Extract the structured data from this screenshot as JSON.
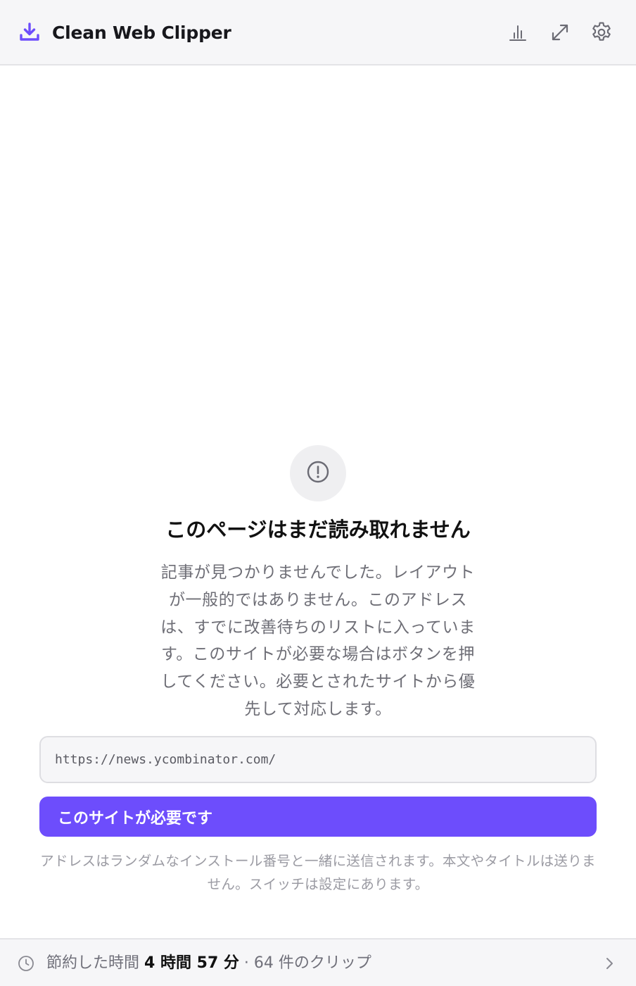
{
  "header": {
    "title": "Clean Web Clipper",
    "brand_icon": "download-tray-icon",
    "actions": [
      {
        "name": "stats-icon"
      },
      {
        "name": "expand-icon"
      },
      {
        "name": "gear-icon"
      }
    ]
  },
  "error": {
    "icon": "alert-circle-icon",
    "title": "このページはまだ読み取れません",
    "body": "記事が見つかりませんでした。レイアウトが一般的ではありません。このアドレスは、すでに改善待ちのリストに入っています。このサイトが必要な場合はボタンを押してください。必要とされたサイトから優先して対応します。"
  },
  "url_field": {
    "value": "https://news.ycombinator.com/"
  },
  "primary_button": {
    "label": "このサイトが必要です"
  },
  "note": "アドレスはランダムなインストール番号と一緒に送信されます。本文やタイトルは送りません。スイッチは設定にあります。",
  "footer": {
    "label": "節約した時間",
    "time_saved": "4 時間 57 分",
    "separator": "·",
    "clips": "64 件のクリップ"
  },
  "colors": {
    "accent": "#6d4dfc",
    "header_bg": "#f6f6f8",
    "muted_text": "#6e6e76"
  }
}
